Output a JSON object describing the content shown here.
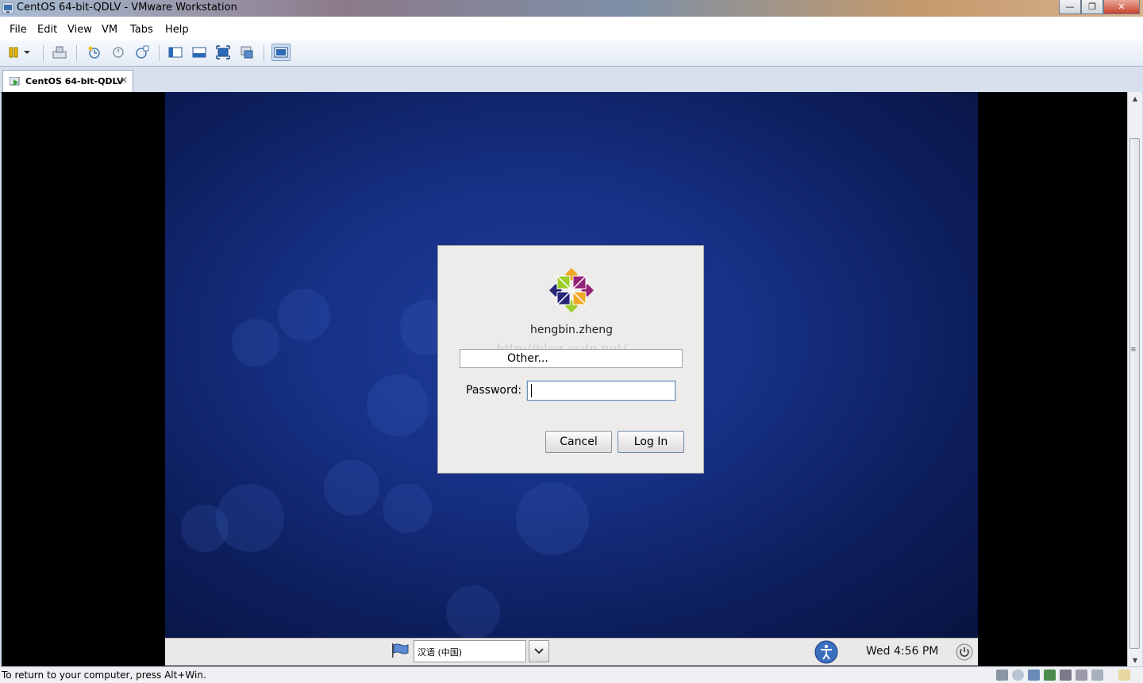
{
  "window": {
    "title": "CentOS 64-bit-QDLV - VMware Workstation",
    "controls": [
      "minimize-icon",
      "maximize-icon",
      "close-icon"
    ]
  },
  "menu": {
    "file": "File",
    "edit": "Edit",
    "view": "View",
    "vm": "VM",
    "tabs": "Tabs",
    "help": "Help"
  },
  "toolbar": {
    "icons": [
      "pause-icon",
      "dropdown-icon",
      "send-ctrl-alt-del-icon",
      "take-snapshot-icon",
      "revert-snapshot-icon",
      "snapshot-manager-icon",
      "show-library-icon",
      "thumbnail-bar-icon",
      "full-screen-icon",
      "unity-icon",
      "console-view-icon"
    ]
  },
  "tab": {
    "label": "CentOS 64-bit-QDLV",
    "close": "✕"
  },
  "login": {
    "username": "hengbin.zheng",
    "other": "Other...",
    "watermark": "http://blog.csdn.net/",
    "password_label": "Password:",
    "password_value": "",
    "cancel": "Cancel",
    "login": "Log In"
  },
  "guest_panel": {
    "language": "汉语 (中国)",
    "clock": "Wed  4:56 PM"
  },
  "status": {
    "message": "To return to your computer, press Alt+Win."
  },
  "colors": {
    "desktop": "#163186",
    "dialog": "#eeeceb",
    "focus": "#6f8fb5"
  }
}
